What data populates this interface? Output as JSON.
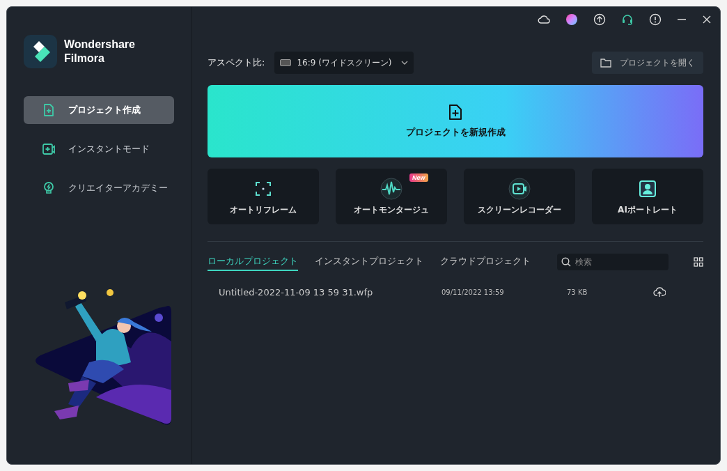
{
  "brand": "Wondershare Filmora",
  "nav": [
    {
      "label": "プロジェクト作成",
      "selected": true
    },
    {
      "label": "インスタントモード",
      "selected": false
    },
    {
      "label": "クリエイターアカデミー",
      "selected": false
    }
  ],
  "aspect": {
    "label": "アスペクト比:",
    "value": "16:9 (ワイドスクリーン)"
  },
  "open_button": "プロジェクトを開く",
  "new_project": "プロジェクトを新規作成",
  "tools": [
    {
      "label": "オートリフレーム"
    },
    {
      "label": "オートモンタージュ",
      "badge": "New"
    },
    {
      "label": "スクリーンレコーダー"
    },
    {
      "label": "AIポートレート"
    }
  ],
  "tabs": [
    {
      "label": "ローカルプロジェクト",
      "selected": true
    },
    {
      "label": "インスタントプロジェクト",
      "selected": false
    },
    {
      "label": "クラウドプロジェクト",
      "selected": false
    }
  ],
  "search": {
    "placeholder": "検索"
  },
  "projects": [
    {
      "name": "Untitled-2022-11-09 13 59 31.wfp",
      "date": "09/11/2022 13:59",
      "size": "73 KB"
    }
  ]
}
